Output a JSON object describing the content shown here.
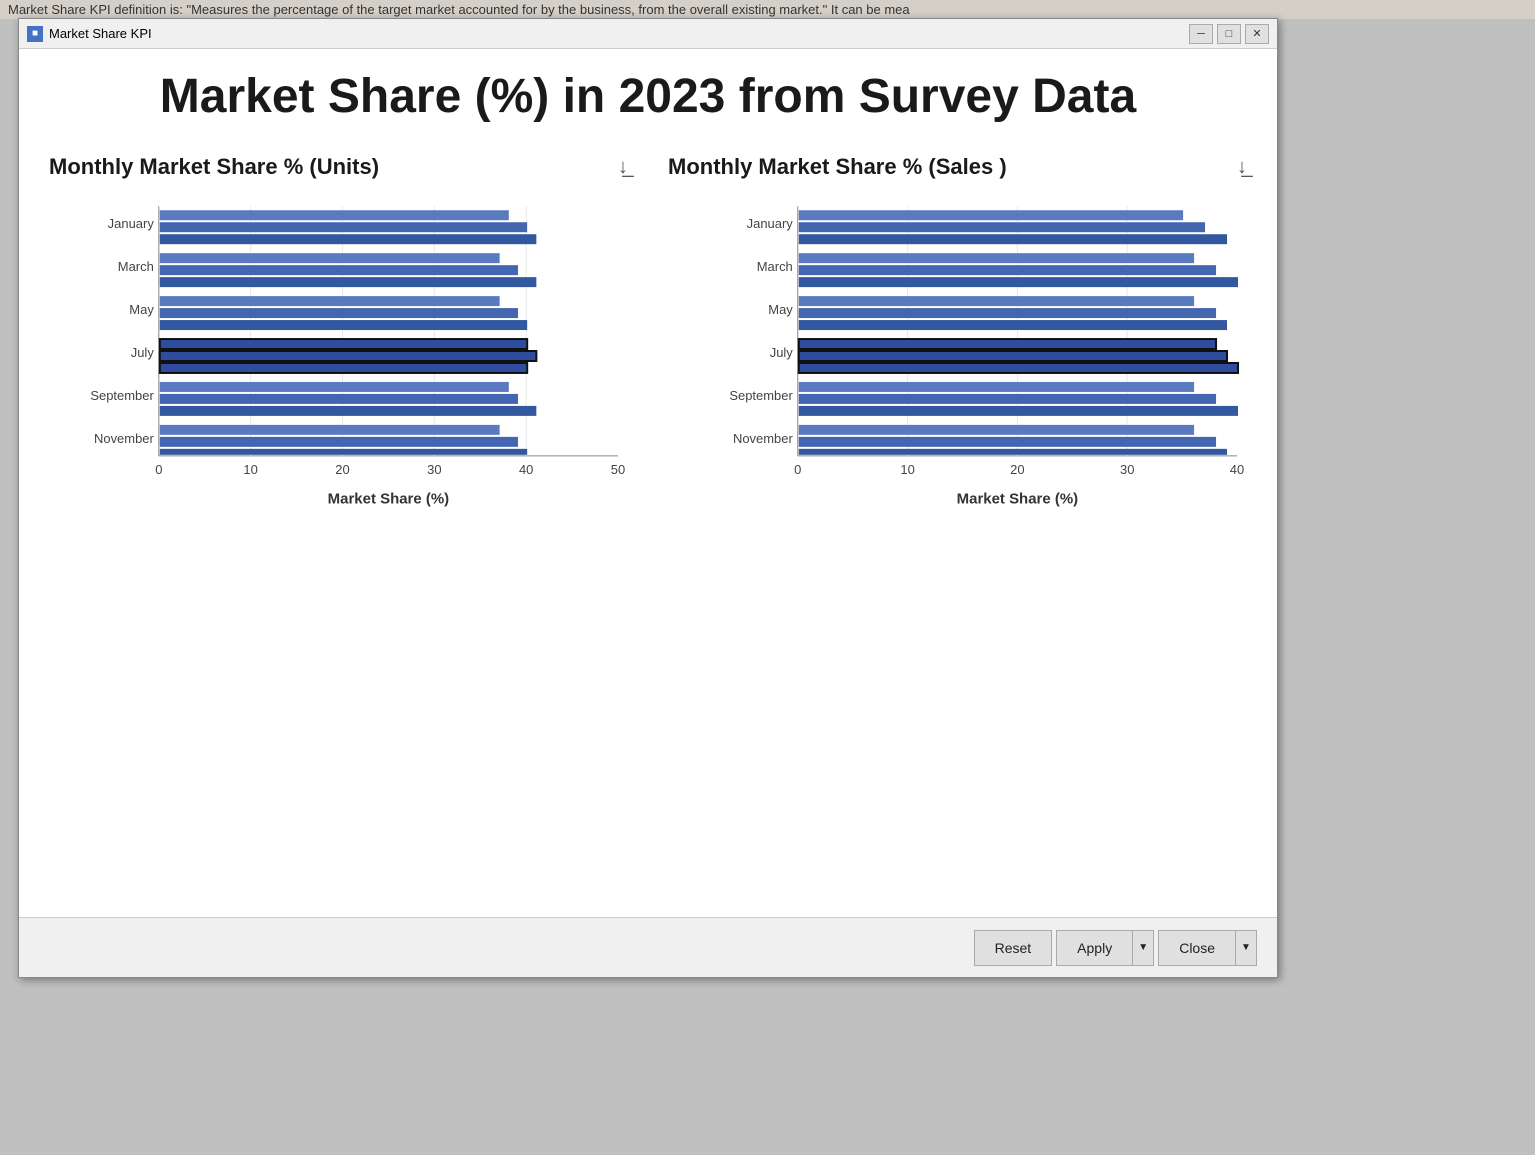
{
  "background": {
    "text": "Market Share KPI definition is: \"Measures the percentage of the target market accounted for by the business, from the overall existing market.\" It can be mea"
  },
  "window": {
    "title": "Market Share KPI",
    "icon": "■"
  },
  "main_title": "Market Share (%) in 2023 from Survey Data",
  "charts": [
    {
      "id": "units",
      "title": "Monthly Market Share % (Units)",
      "x_axis_title": "Market Share (%)",
      "x_labels": [
        "0",
        "10",
        "20",
        "30",
        "40",
        "50"
      ],
      "x_max": 50,
      "months": [
        "January",
        "March",
        "May",
        "July",
        "September",
        "November"
      ],
      "bars": [
        {
          "month": "January",
          "values": [
            38,
            40,
            41
          ]
        },
        {
          "month": "March",
          "values": [
            37,
            39,
            41
          ]
        },
        {
          "month": "May",
          "values": [
            37,
            39,
            40
          ]
        },
        {
          "month": "July",
          "values": [
            40,
            41,
            40
          ],
          "highlight": true
        },
        {
          "month": "September",
          "values": [
            38,
            39,
            41
          ]
        },
        {
          "month": "November",
          "values": [
            37,
            39,
            40
          ]
        }
      ]
    },
    {
      "id": "sales",
      "title": "Monthly Market Share % (Sales )",
      "x_axis_title": "Market Share (%)",
      "x_labels": [
        "0",
        "10",
        "20",
        "30",
        "40"
      ],
      "x_max": 40,
      "months": [
        "January",
        "March",
        "May",
        "July",
        "September",
        "November"
      ],
      "bars": [
        {
          "month": "January",
          "values": [
            35,
            37,
            39
          ]
        },
        {
          "month": "March",
          "values": [
            36,
            38,
            40
          ]
        },
        {
          "month": "May",
          "values": [
            36,
            38,
            39
          ]
        },
        {
          "month": "July",
          "values": [
            38,
            39,
            40
          ],
          "highlight": true
        },
        {
          "month": "September",
          "values": [
            36,
            38,
            40
          ]
        },
        {
          "month": "November",
          "values": [
            36,
            38,
            39
          ]
        }
      ]
    }
  ],
  "toolbar": {
    "reset_label": "Reset",
    "apply_label": "Apply",
    "close_label": "Close"
  },
  "title_bar_controls": {
    "minimize": "─",
    "maximize": "□",
    "close": "✕"
  }
}
